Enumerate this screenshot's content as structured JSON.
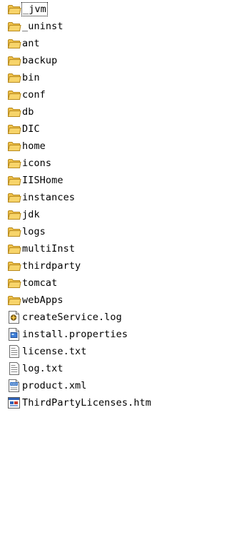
{
  "colors": {
    "folder_body": "#F7D46A",
    "folder_tab": "#F0C24A",
    "folder_edge": "#B88A1E",
    "text": "#000000",
    "background": "#FFFFFF"
  },
  "items": [
    {
      "name": "_jvm",
      "type": "folder",
      "icon": "folder-icon",
      "focused": true
    },
    {
      "name": "_uninst",
      "type": "folder",
      "icon": "folder-icon"
    },
    {
      "name": "ant",
      "type": "folder",
      "icon": "folder-icon"
    },
    {
      "name": "backup",
      "type": "folder",
      "icon": "folder-icon"
    },
    {
      "name": "bin",
      "type": "folder",
      "icon": "folder-icon"
    },
    {
      "name": "conf",
      "type": "folder",
      "icon": "folder-icon"
    },
    {
      "name": "db",
      "type": "folder",
      "icon": "folder-icon"
    },
    {
      "name": "DIC",
      "type": "folder",
      "icon": "folder-icon"
    },
    {
      "name": "home",
      "type": "folder",
      "icon": "folder-icon"
    },
    {
      "name": "icons",
      "type": "folder",
      "icon": "folder-icon"
    },
    {
      "name": "IISHome",
      "type": "folder",
      "icon": "folder-icon"
    },
    {
      "name": "instances",
      "type": "folder",
      "icon": "folder-icon"
    },
    {
      "name": "jdk",
      "type": "folder",
      "icon": "folder-icon"
    },
    {
      "name": "logs",
      "type": "folder",
      "icon": "folder-icon"
    },
    {
      "name": "multiInst",
      "type": "folder",
      "icon": "folder-icon"
    },
    {
      "name": "thirdparty",
      "type": "folder",
      "icon": "folder-icon"
    },
    {
      "name": "tomcat",
      "type": "folder",
      "icon": "folder-icon"
    },
    {
      "name": "webApps",
      "type": "folder",
      "icon": "folder-icon"
    },
    {
      "name": "createService.log",
      "type": "file",
      "icon": "log-file-icon"
    },
    {
      "name": "install.properties",
      "type": "file",
      "icon": "properties-file-icon"
    },
    {
      "name": "license.txt",
      "type": "file",
      "icon": "text-file-icon"
    },
    {
      "name": "log.txt",
      "type": "file",
      "icon": "text-file-icon"
    },
    {
      "name": "product.xml",
      "type": "file",
      "icon": "xml-file-icon"
    },
    {
      "name": "ThirdPartyLicenses.htm",
      "type": "file",
      "icon": "html-file-icon"
    }
  ]
}
